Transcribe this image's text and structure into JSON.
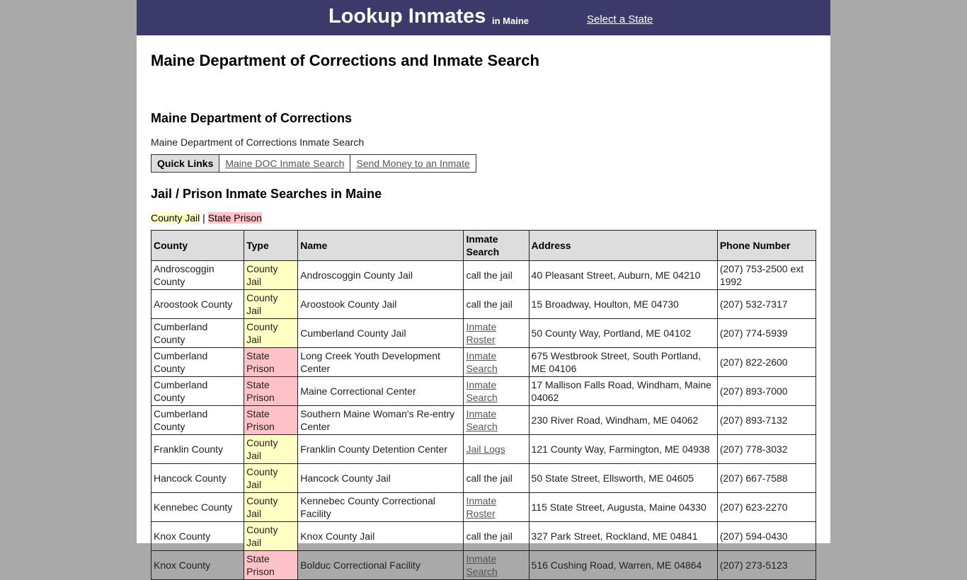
{
  "header": {
    "brand": "Lookup Inmates",
    "brand_sub": "in Maine",
    "select_state": "Select a State",
    "bg_color": "#3b3a6b"
  },
  "page_title": "Maine Department of Corrections and Inmate Search",
  "doc_section": {
    "title": "Maine Department of Corrections",
    "description": "Maine Department of Corrections Inmate Search",
    "quick_links_label": "Quick Links",
    "links": [
      "Maine DOC Inmate Search",
      "Send Money to an Inmate"
    ]
  },
  "jail_section": {
    "title": "Jail / Prison Inmate Searches in Maine",
    "legend": {
      "county_jail": "County Jail",
      "separator": "|",
      "state_prison": "State Prison"
    },
    "colors": {
      "county_jail": "#ffffc4",
      "state_prison": "#ffc2c8"
    }
  },
  "table": {
    "headers": [
      "County",
      "Type",
      "Name",
      "Inmate Search",
      "Address",
      "Phone Number"
    ],
    "rows": [
      {
        "county": "Androscoggin County",
        "type": "County Jail",
        "name": "Androscoggin County Jail",
        "search": "call the jail",
        "search_link": false,
        "address": "40 Pleasant Street, Auburn, ME 04210",
        "phone": "(207) 753-2500 ext 1992"
      },
      {
        "county": "Aroostook County",
        "type": "County Jail",
        "name": "Aroostook County Jail",
        "search": "call the jail",
        "search_link": false,
        "address": "15 Broadway, Houlton, ME 04730",
        "phone": "(207) 532-7317"
      },
      {
        "county": "Cumberland County",
        "type": "County Jail",
        "name": "Cumberland County Jail",
        "search": "Inmate Roster",
        "search_link": true,
        "address": "50 County Way, Portland, ME 04102",
        "phone": "(207) 774-5939"
      },
      {
        "county": "Cumberland County",
        "type": "State Prison",
        "name": "Long Creek Youth Development Center",
        "search": "Inmate Search",
        "search_link": true,
        "address": "675 Westbrook Street, South Portland, ME 04106",
        "phone": "(207) 822-2600"
      },
      {
        "county": "Cumberland County",
        "type": "State Prison",
        "name": "Maine Correctional Center",
        "search": "Inmate Search",
        "search_link": true,
        "address": "17 Mallison Falls Road, Windham, Maine 04062",
        "phone": "(207) 893-7000"
      },
      {
        "county": "Cumberland County",
        "type": "State Prison",
        "name": "Southern Maine Woman's Re-entry Center",
        "search": "Inmate Search",
        "search_link": true,
        "address": "230 River Road, Windham, ME 04062",
        "phone": "(207) 893-7132"
      },
      {
        "county": "Franklin County",
        "type": "County Jail",
        "name": "Franklin County Detention Center",
        "search": "Jail Logs",
        "search_link": true,
        "address": "121 County Way, Farmington, ME 04938",
        "phone": "(207) 778-3032"
      },
      {
        "county": "Hancock County",
        "type": "County Jail",
        "name": "Hancock County Jail",
        "search": "call the jail",
        "search_link": false,
        "address": "50 State Street, Ellsworth, ME 04605",
        "phone": "(207) 667-7588"
      },
      {
        "county": "Kennebec County",
        "type": "County Jail",
        "name": "Kennebec County Correctional Facility",
        "search": "Inmate Roster",
        "search_link": true,
        "address": "115 State Street, Augusta, Maine 04330",
        "phone": "(207) 623-2270"
      },
      {
        "county": "Knox County",
        "type": "County Jail",
        "name": "Knox County Jail",
        "search": "call the jail",
        "search_link": false,
        "address": "327 Park Street, Rockland, ME 04841",
        "phone": "(207) 594-0430"
      },
      {
        "county": "Knox County",
        "type": "State Prison",
        "name": "Bolduc Correctional Facility",
        "search": "Inmate Search",
        "search_link": true,
        "address": "516 Cushing Road, Warren, ME 04864",
        "phone": "(207) 273-5123"
      }
    ]
  }
}
